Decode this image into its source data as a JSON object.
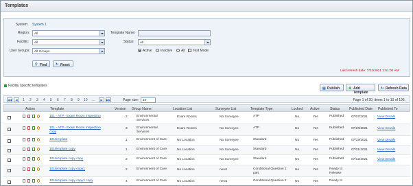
{
  "page": {
    "title": "Templates"
  },
  "filters": {
    "system_label": "System:",
    "system_value": "System 1",
    "region_label": "Region:",
    "region_value": "All",
    "template_name_label": "Template Name:",
    "template_name_value": "",
    "facility_label": "Facility:",
    "facility_value": "All",
    "status_label": "Status:",
    "status_value": "All",
    "user_groups_label": "User Groups:",
    "user_groups_value": "All Groups",
    "radio_active": "Active",
    "radio_inactive": "Inactive",
    "radio_all": "All",
    "test_mode_label": "Test Mode",
    "find_label": "Find",
    "reset_label": "Reset"
  },
  "refresh_text": "Last refresh date: 7/22/2021 2:51:00 AM",
  "facility_note": "Facility specific templates",
  "toolbar": {
    "publish": "Publish",
    "add_template": "Add Template",
    "refresh_data": "Refresh Data"
  },
  "pager": {
    "pages": [
      "1",
      "2",
      "3",
      "4",
      "5",
      "6",
      "7",
      "8",
      "9",
      "10",
      "..."
    ],
    "page_size_label": "Page size:",
    "page_size": "10",
    "info": "Page 1 of 20, items 1 to 10 of 196."
  },
  "columns": [
    "Action",
    "Template",
    "Version",
    "Group Name",
    "Location List",
    "Surveyee List",
    "Template Type",
    "Locked",
    "Active",
    "Status",
    "Published Date",
    "Published To"
  ],
  "rows": [
    {
      "template": [
        "101 - ATP - Exam Room Inspection",
        ""
      ],
      "version": "2",
      "group": [
        "Environmental",
        "Services"
      ],
      "location": "Exam Rooms",
      "surveyee": "No Surveyee",
      "type": [
        "ATP",
        ""
      ],
      "locked": "No",
      "active": "Yes",
      "status": [
        "Published",
        ""
      ],
      "date": "07/07/2021",
      "to": "View Details"
    },
    {
      "template": [
        "101 - ATP - Exam Room Inspection",
        "copy"
      ],
      "version": "3",
      "group": [
        "Environmental",
        "Services"
      ],
      "location": "Exam Rooms",
      "surveyee": "No Surveyee",
      "type": [
        "ATP",
        ""
      ],
      "locked": "No",
      "active": "Yes",
      "status": [
        "Published",
        ""
      ],
      "date": "07/20/2021",
      "to": "View Details"
    },
    {
      "template": [
        "101template",
        ""
      ],
      "version": "1",
      "group": [
        "Environment of Care",
        ""
      ],
      "location": "No Location",
      "surveyee": "No Surveyee",
      "type": [
        "Standard",
        ""
      ],
      "locked": "No",
      "active": "Yes",
      "status": [
        "Published",
        ""
      ],
      "date": "07/19/2021",
      "to": "View Details"
    },
    {
      "template": [
        "101template copy",
        ""
      ],
      "version": "1",
      "group": [
        "Environment of Care",
        ""
      ],
      "location": "No Location",
      "surveyee": "No Surveyee",
      "type": [
        "Standard",
        ""
      ],
      "locked": "No",
      "active": "Yes",
      "status": [
        "Published",
        ""
      ],
      "date": "07/01/2021",
      "to": "View Details"
    },
    {
      "template": [
        "101template copy copy",
        ""
      ],
      "version": "2",
      "group": [
        "Environment of Care",
        ""
      ],
      "location": "No Location",
      "surveyee": "No Surveyee",
      "type": [
        "Standard",
        ""
      ],
      "locked": "No",
      "active": "Yes",
      "status": [
        "Published",
        ""
      ],
      "date": "07/12/2021",
      "to": "View Details"
    },
    {
      "template": [
        "101template copy copy1",
        ""
      ],
      "version": "2",
      "group": [
        "Environment of Care",
        ""
      ],
      "location": "No Location",
      "surveyee": "new1",
      "type": [
        "Conditional Question 2",
        "part"
      ],
      "locked": "No",
      "active": "Yes",
      "status": [
        "Ready to",
        "Release"
      ],
      "date": "",
      "to": ""
    },
    {
      "template": [
        "101template copy copy1 copy",
        ""
      ],
      "version": "4",
      "group": [
        "Environment of Care",
        ""
      ],
      "location": "No Location",
      "surveyee": "new1",
      "type": [
        "Conditional Question 2",
        ""
      ],
      "locked": "No",
      "active": "Yes",
      "status": [
        "Ready to",
        ""
      ],
      "date": "",
      "to": ""
    }
  ]
}
